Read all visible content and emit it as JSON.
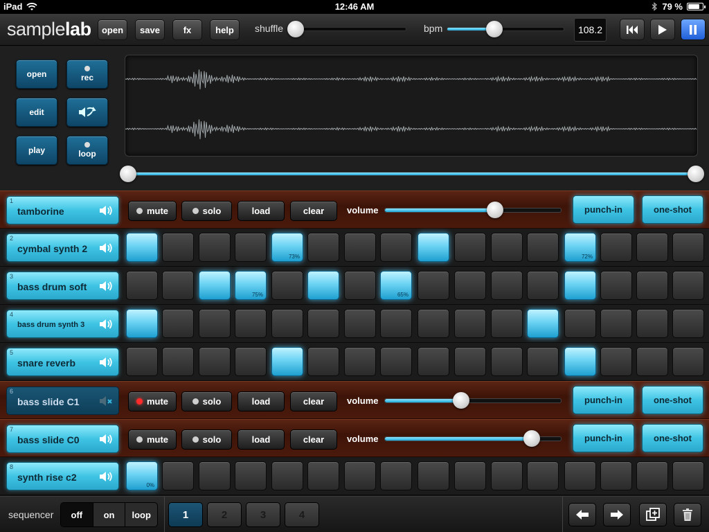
{
  "status_bar": {
    "device": "iPad",
    "time": "12:46 AM",
    "battery_percent": "79 %",
    "battery_level": 0.79
  },
  "toolbar": {
    "logo_a": "sample",
    "logo_b": "lab",
    "buttons": {
      "open": "open",
      "save": "save",
      "fx": "fx",
      "help": "help"
    },
    "shuffle_label": "shuffle",
    "shuffle_value": 0.0,
    "bpm_label": "bpm",
    "bpm_slider_value": 0.4,
    "bpm_value": "108.2"
  },
  "sample_editor": {
    "buttons": {
      "open": "open",
      "rec": "rec",
      "edit": "edit",
      "play": "play",
      "loop": "loop"
    },
    "range_start": 0.0,
    "range_end": 1.0
  },
  "track_controls": {
    "mute": "mute",
    "solo": "solo",
    "load": "load",
    "clear": "clear",
    "volume": "volume",
    "punch_in": "punch-in",
    "one_shot": "one-shot"
  },
  "tracks": [
    {
      "num": "1",
      "name": "tamborine",
      "expanded": true,
      "muted": false,
      "volume": 0.62
    },
    {
      "num": "2",
      "name": "cymbal synth 2",
      "expanded": false,
      "steps": [
        1,
        0,
        0,
        0,
        1,
        0,
        0,
        0,
        1,
        0,
        0,
        0,
        1,
        0,
        0,
        0
      ],
      "labels": {
        "4": "73%",
        "12": "72%"
      }
    },
    {
      "num": "3",
      "name": "bass drum soft",
      "expanded": false,
      "steps": [
        0,
        0,
        1,
        1,
        0,
        1,
        0,
        1,
        0,
        0,
        0,
        0,
        1,
        0,
        0,
        0
      ],
      "labels": {
        "3": "75%",
        "7": "65%"
      }
    },
    {
      "num": "4",
      "name": "bass drum synth 3",
      "expanded": false,
      "small": true,
      "steps": [
        1,
        0,
        0,
        0,
        0,
        0,
        0,
        0,
        0,
        0,
        0,
        1,
        0,
        0,
        0,
        0
      ],
      "labels": {}
    },
    {
      "num": "5",
      "name": "snare reverb",
      "expanded": false,
      "steps": [
        0,
        0,
        0,
        0,
        1,
        0,
        0,
        0,
        0,
        0,
        0,
        0,
        1,
        0,
        0,
        0
      ],
      "labels": {}
    },
    {
      "num": "6",
      "name": "bass slide C1",
      "expanded": true,
      "muted": true,
      "volume": 0.43
    },
    {
      "num": "7",
      "name": "bass slide C0",
      "expanded": true,
      "muted": false,
      "volume": 0.83
    },
    {
      "num": "8",
      "name": "synth rise c2",
      "expanded": false,
      "steps": [
        1,
        0,
        0,
        0,
        0,
        0,
        0,
        0,
        0,
        0,
        0,
        0,
        0,
        0,
        0,
        0
      ],
      "labels": {
        "0": "0%"
      }
    }
  ],
  "bottom": {
    "sequencer_label": "sequencer",
    "modes": [
      "off",
      "on",
      "loop"
    ],
    "selected_mode": "off",
    "pages": [
      "1",
      "2",
      "3",
      "4"
    ],
    "selected_page": "1"
  },
  "colors": {
    "accent": "#3fc4e4",
    "track_wood": "#4a1a0c",
    "active_transport": "#1f5fd8"
  },
  "icons": [
    "wifi-icon",
    "bluetooth-icon",
    "battery-icon",
    "rewind-icon",
    "play-icon",
    "pause-icon",
    "speaker-icon",
    "speaker-muted-icon",
    "sample-direction-icon",
    "arrow-left-icon",
    "arrow-right-icon",
    "duplicate-icon",
    "trash-icon"
  ]
}
